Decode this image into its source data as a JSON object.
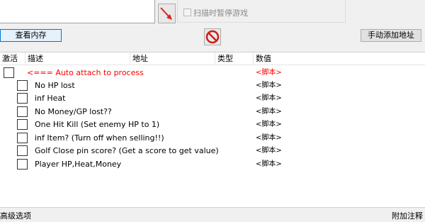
{
  "top": {
    "scan_pause_label": "扫描时暂停游戏",
    "arrow_icon": "red-arrow-icon",
    "no_icon": "no-entry-icon"
  },
  "toolbar": {
    "view_memory": "查看内存",
    "manual_add": "手动添加地址"
  },
  "columns": {
    "active": "激活",
    "description": "描述",
    "address": "地址",
    "type": "类型",
    "value": "数值"
  },
  "rows": [
    {
      "description": "<=== Auto attach to process",
      "value": "<脚本>",
      "color": "#ff0000"
    },
    {
      "description": "No HP lost",
      "value": "<脚本>"
    },
    {
      "description": "inf Heat",
      "value": "<脚本>"
    },
    {
      "description": "No Money/GP lost??",
      "value": "<脚本>"
    },
    {
      "description": "One Hit Kill (Set enemy HP to 1)",
      "value": "<脚本>"
    },
    {
      "description": "inf Item? (Turn off when selling!!)",
      "value": "<脚本>"
    },
    {
      "description": "Golf Close pin score? (Get a score to get value)",
      "value": "<脚本>"
    },
    {
      "description": "Player HP,Heat,Money",
      "value": "<脚本>"
    }
  ],
  "status": {
    "advanced": "高级选项",
    "comments": "附加注释"
  }
}
